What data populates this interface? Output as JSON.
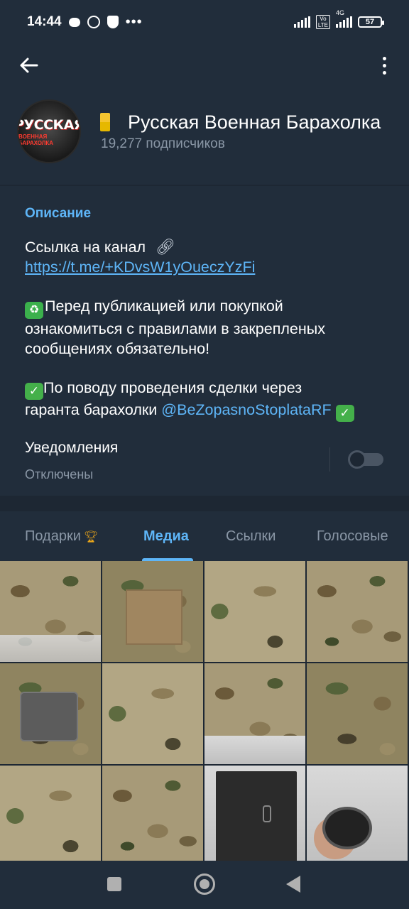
{
  "status_bar": {
    "time": "14:44",
    "network": "4G",
    "battery": "57"
  },
  "header": {
    "channel_title": "Русская Военная Барахолка",
    "subscribers": "19,277 подписчиков",
    "avatar": {
      "line1": "РУССКАЯ",
      "line2": "ВОЕННАЯ БАРАХОЛКА"
    }
  },
  "description": {
    "label": "Описание",
    "line1": "Ссылка на канал",
    "link": "https://t.me/+KDvsW1yOueczYzFi",
    "para2_line1": "Перед публикацией или покупкой",
    "para2_line2": "ознакомиться с правилами в закрепленых",
    "para2_line3": "сообщениях обязательно!",
    "para3_line1": "По поводу проведения сделки через",
    "para3_line2_prefix": "гаранта барахолки",
    "mention": "@BeZopasnoStoplataRF"
  },
  "notifications": {
    "label": "Уведомления",
    "status": "Отключены",
    "enabled": false
  },
  "tabs": [
    {
      "label": "Подарки",
      "active": false
    },
    {
      "label": "Медиа",
      "active": true
    },
    {
      "label": "Ссылки",
      "active": false
    },
    {
      "label": "Голосовые",
      "active": false
    }
  ],
  "media_grid": {
    "count": 12
  },
  "colors": {
    "background": "#1d2733",
    "panel": "#212d3b",
    "accent": "#5eb5f7",
    "secondary_text": "#8a97a6"
  },
  "icons": {
    "back": "arrow-left-icon",
    "more": "more-vertical-icon",
    "link": "link-icon",
    "recycle": "recycle-emoji-icon",
    "check": "check-mark-emoji-icon",
    "trophy": "trophy-icon"
  }
}
